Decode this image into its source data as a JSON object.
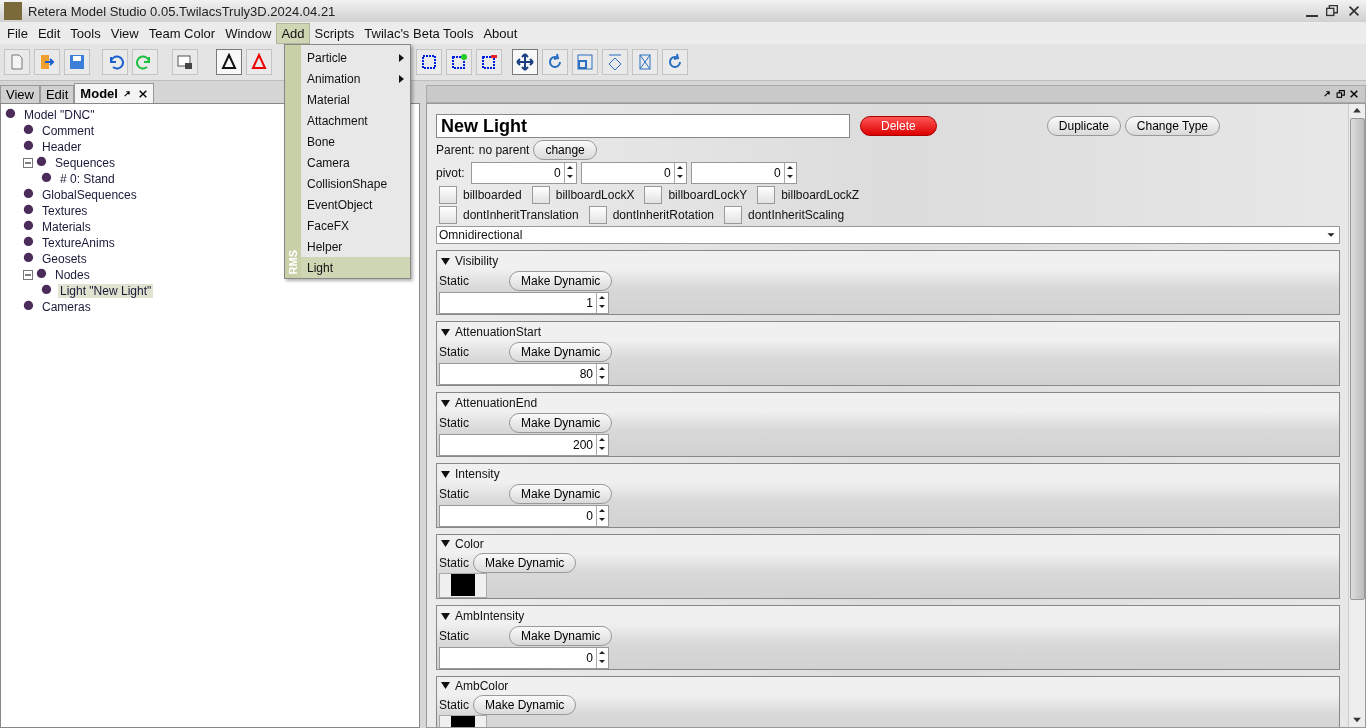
{
  "window": {
    "title": "Retera Model Studio 0.05.TwilacsTruly3D.2024.04.21"
  },
  "menu": [
    {
      "label": "File",
      "selected": false
    },
    {
      "label": "Edit",
      "selected": false
    },
    {
      "label": "Tools",
      "selected": false
    },
    {
      "label": "View",
      "selected": false
    },
    {
      "label": "Team Color",
      "selected": false
    },
    {
      "label": "Window",
      "selected": false
    },
    {
      "label": "Add",
      "selected": true
    },
    {
      "label": "Scripts",
      "selected": false
    },
    {
      "label": "Twilac's Beta Tools",
      "selected": false
    },
    {
      "label": "About",
      "selected": false
    }
  ],
  "add_menu": {
    "side_label": "RMS",
    "items": [
      {
        "label": "Particle",
        "submenu": true,
        "selected": false
      },
      {
        "label": "Animation",
        "submenu": true,
        "selected": false
      },
      {
        "label": "Material",
        "submenu": false,
        "selected": false
      },
      {
        "label": "Attachment",
        "submenu": false,
        "selected": false
      },
      {
        "label": "Bone",
        "submenu": false,
        "selected": false
      },
      {
        "label": "Camera",
        "submenu": false,
        "selected": false
      },
      {
        "label": "CollisionShape",
        "submenu": false,
        "selected": false
      },
      {
        "label": "EventObject",
        "submenu": false,
        "selected": false
      },
      {
        "label": "FaceFX",
        "submenu": false,
        "selected": false
      },
      {
        "label": "Helper",
        "submenu": false,
        "selected": false
      },
      {
        "label": "Light",
        "submenu": false,
        "selected": true
      }
    ]
  },
  "left_tabs": [
    {
      "label": "View",
      "selected": false
    },
    {
      "label": "Edit",
      "selected": false
    },
    {
      "label": "Model",
      "selected": true
    }
  ],
  "tree": [
    {
      "label": "Model \"DNC\"",
      "selected": false,
      "children": [
        {
          "label": "Comment",
          "selected": false
        },
        {
          "label": "Header",
          "selected": false
        },
        {
          "label": "Sequences",
          "selected": false,
          "expanded": true,
          "children": [
            {
              "label": "# 0: Stand",
              "selected": false
            }
          ]
        },
        {
          "label": "GlobalSequences",
          "selected": false
        },
        {
          "label": "Textures",
          "selected": false
        },
        {
          "label": "Materials",
          "selected": false
        },
        {
          "label": "TextureAnims",
          "selected": false
        },
        {
          "label": "Geosets",
          "selected": false
        },
        {
          "label": "Nodes",
          "selected": false,
          "expanded": true,
          "children": [
            {
              "label": "Light \"New Light\"",
              "selected": true
            }
          ]
        },
        {
          "label": "Cameras",
          "selected": false
        }
      ]
    }
  ],
  "editor": {
    "name": "New Light",
    "delete": "Delete",
    "duplicate": "Duplicate",
    "change_type": "Change Type",
    "parent_label": "Parent:",
    "parent_value": "no parent",
    "change": "change",
    "pivot_label": "pivot:",
    "pivot": [
      "0",
      "0",
      "0"
    ],
    "flags": [
      [
        {
          "label": "billboarded",
          "checked": false
        },
        {
          "label": "billboardLockX",
          "checked": false
        },
        {
          "label": "billboardLockY",
          "checked": false
        },
        {
          "label": "billboardLockZ",
          "checked": false
        }
      ],
      [
        {
          "label": "dontInheritTranslation",
          "checked": false
        },
        {
          "label": "dontInheritRotation",
          "checked": false
        },
        {
          "label": "dontInheritScaling",
          "checked": false
        }
      ]
    ],
    "light_type": "Omnidirectional",
    "sections": [
      {
        "title": "Visibility",
        "expanded": true,
        "kind": "number",
        "static": "Static",
        "button": "Make Dynamic",
        "value": "1"
      },
      {
        "title": "AttenuationStart",
        "expanded": true,
        "kind": "number",
        "static": "Static",
        "button": "Make Dynamic",
        "value": "80"
      },
      {
        "title": "AttenuationEnd",
        "expanded": true,
        "kind": "number",
        "static": "Static",
        "button": "Make Dynamic",
        "value": "200"
      },
      {
        "title": "Intensity",
        "expanded": true,
        "kind": "number",
        "static": "Static",
        "button": "Make Dynamic",
        "value": "0"
      },
      {
        "title": "Color",
        "expanded": true,
        "kind": "color",
        "static": "Static",
        "button": "Make Dynamic",
        "color": "#000000"
      },
      {
        "title": "AmbIntensity",
        "expanded": true,
        "kind": "number",
        "static": "Static",
        "button": "Make Dynamic",
        "value": "0"
      },
      {
        "title": "AmbColor",
        "expanded": true,
        "kind": "color",
        "static": "Static",
        "button": "Make Dynamic",
        "color": "#000000"
      }
    ]
  }
}
